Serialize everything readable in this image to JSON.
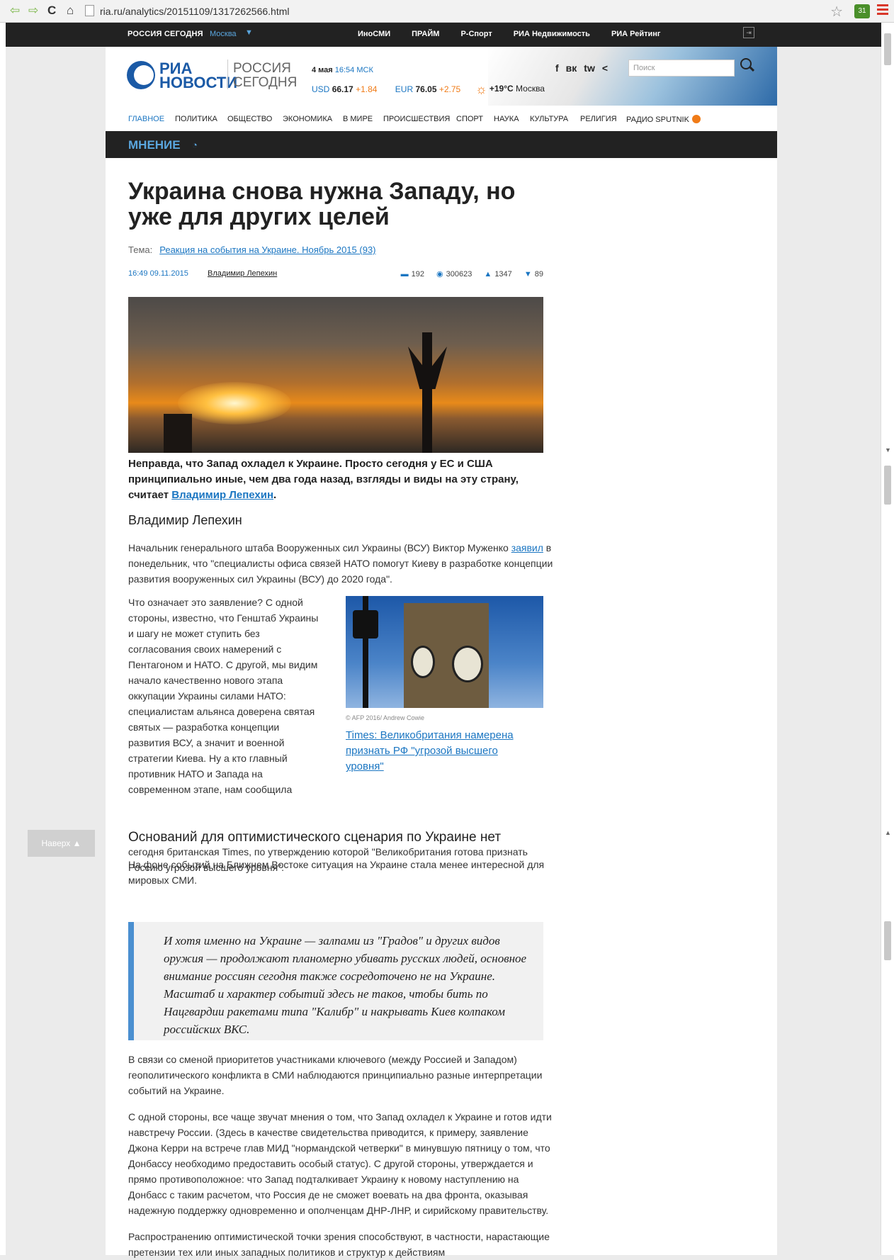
{
  "browser": {
    "url": "ria.ru/analytics/20151109/1317262566.html",
    "ext_badge": "31"
  },
  "topbar": {
    "logo": "РОССИЯ СЕГОДНЯ",
    "city": "Москва",
    "links": [
      "ИноСМИ",
      "ПРАЙМ",
      "Р-Спорт",
      "РИА Недвижимость",
      "РИА Рейтинг"
    ]
  },
  "header": {
    "logo_line1": "РИА",
    "logo_line2": "НОВОСТИ",
    "rs_line1": "РОССИЯ",
    "rs_line2": "СЕГОДНЯ",
    "date": "4 мая",
    "time": "16:54 МСК",
    "usd_label": "USD",
    "usd_value": "66.17",
    "usd_delta": "+1.84",
    "eur_label": "EUR",
    "eur_value": "76.05",
    "eur_delta": "+2.75",
    "temp": "+19°C",
    "weather_city": "Москва",
    "social": [
      "f",
      "вк",
      "tw",
      "<"
    ],
    "search_placeholder": "Поиск"
  },
  "nav": {
    "items": [
      "ГЛАВНОЕ",
      "ПОЛИТИКА",
      "ОБЩЕСТВО",
      "ЭКОНОМИКА",
      "В МИРЕ",
      "ПРОИСШЕСТВИЯ",
      "СПОРТ",
      "НАУКА",
      "КУЛЬТУРА",
      "РЕЛИГИЯ",
      "РАДИО SPUTNIK"
    ]
  },
  "section": {
    "label": "МНЕНИЕ"
  },
  "article": {
    "title": "Украина снова нужна Западу, но уже для других целей",
    "theme_label": "Тема:",
    "theme_link": "Реакция на события на Украине. Ноябрь 2015 (93)",
    "time": "16:49",
    "date": "09.11.2015",
    "author": "Владимир Лепехин",
    "comments": "192",
    "views": "300623",
    "likes": "1347",
    "dislikes": "89",
    "lead_text": "Неправда, что Запад охладел к Украине. Просто сегодня у ЕС и США принципиально иные, чем два года назад, взгляды и виды на эту страну, считает ",
    "lead_link": "Владимир Лепехин",
    "lead_end": ".",
    "author_heading": "Владимир Лепехин",
    "p1_start": "Начальник генерального штаба Вооруженных сил Украины (ВСУ) Виктор Муженко ",
    "p1_link": "заявил",
    "p1_end": " в понедельник, что \"специалисты офиса связей НАТО помогут Киеву в разработке концепции развития вооруженных сил Украины (ВСУ) до 2020 года\".",
    "p2_wrap": "Что означает это заявление? С одной стороны, известно, что Генштаб Украины и шагу не может ступить без согласования своих намерений с Пентагоном и НАТО. С другой, мы видим начало качественно нового этапа оккупации Украины силами НАТО: специалистам альянса доверена святая святых — разработка концепции развития ВСУ, а значит и военной стратегии Киева. Ну а кто главный противник НАТО и Запада на современном этапе, нам сообщила",
    "p2_tail": "сегодня британская Times, по утверждению которой \"Великобритания готова признать Россию угрозой высшего уровня\".",
    "aside_credit": "© AFP 2016/ Andrew Cowie",
    "aside_link": "Times: Великобритания намерена признать РФ \"угрозой высшего уровня\"",
    "subheading": "Оснований для оптимистического сценария по Украине нет",
    "p3": "На фоне событий на Ближнем Востоке ситуация на Украине стала менее интересной для мировых СМИ.",
    "quote": "И хотя именно на Украине — залпами из \"Градов\" и других видов оружия — продолжают планомерно убивать русских людей, основное внимание россиян сегодня также сосредоточено не на Украине. Масштаб и характер событий здесь не таков, чтобы бить по Нацгвардии ракетами типа \"Калибр\" и накрывать Киев колпаком российских ВКС.",
    "p4": "В связи со сменой приоритетов участниками ключевого (между Россией и Западом) геополитического конфликта в СМИ наблюдаются принципиально разные интерпретации событий на Украине.",
    "p5": "С одной стороны, все чаще звучат мнения о том, что Запад охладел к Украине и готов идти навстречу России. (Здесь в качестве свидетельства приводится, к примеру, заявление Джона Керри на встрече глав МИД \"нормандской четверки\" в минувшую пятницу о том, что Донбассу необходимо предоставить особый статус). С другой стороны, утверждается и прямо противоположное: что Запад подталкивает Украину к новому наступлению на Донбасс с таким расчетом, что Россия де не сможет воевать на два фронта, оказывая надежную поддержку одновременно и ополченцам ДНР-ЛНР, и сирийскому правительству.",
    "p6": "Распространению оптимистической точки зрения способствуют, в частности, нарастающие претензии тех или иных западных политиков и структур к действиям"
  },
  "totop": {
    "label": "Наверх ▲"
  }
}
